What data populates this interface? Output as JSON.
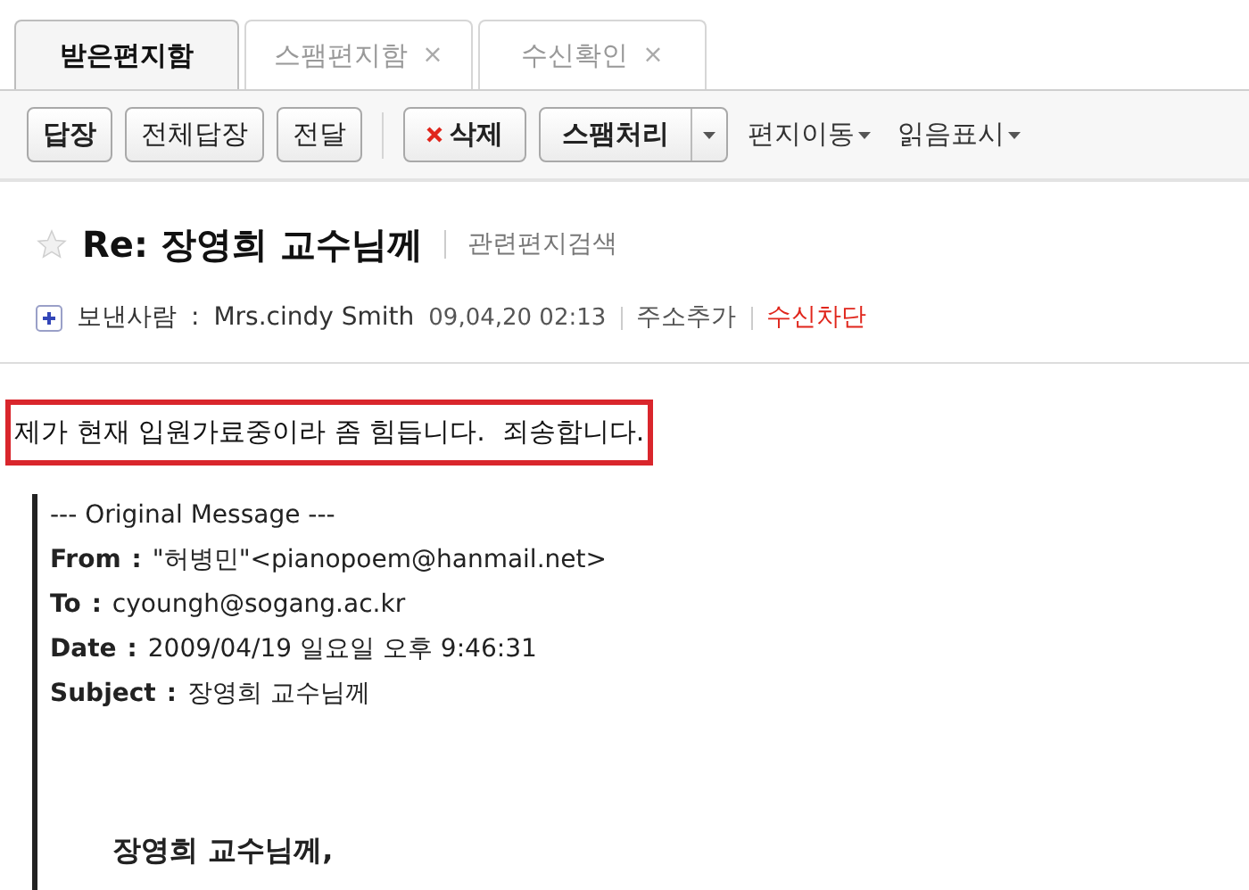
{
  "tabs": [
    {
      "label": "받은편지함",
      "selected": true
    },
    {
      "label": "스팸편지함",
      "selected": false,
      "close": "×"
    },
    {
      "label": "수신확인",
      "selected": false,
      "close": "×"
    }
  ],
  "toolbar": [
    {
      "kind": "button",
      "label": "답장",
      "bold": true
    },
    {
      "kind": "button",
      "label": "전체답장",
      "bold": false
    },
    {
      "kind": "button",
      "label": "전달",
      "bold": false
    },
    {
      "kind": "separator"
    },
    {
      "kind": "delete",
      "label": "삭제",
      "bold": true
    },
    {
      "kind": "split",
      "label": "스팸처리",
      "bold": true
    },
    {
      "kind": "menu",
      "label": "편지이동"
    },
    {
      "kind": "menu",
      "label": "읽음표시"
    }
  ],
  "message": {
    "starred": false,
    "subject": "Re: 장영희 교수님께",
    "related_link": "관련편지검색",
    "sender_label": "보낸사람",
    "sender_separator": ":",
    "sender": "Mrs.cindy Smith",
    "date": "09,04,20 02:13",
    "add_address": "주소추가",
    "block": "수신차단"
  },
  "body": {
    "highlighted": "제가 현재 입원가료중이라 좀 힘듭니다.  죄송합니다.",
    "quote_header": "--- Original Message ---",
    "headers": [
      {
        "label": "From",
        "value": "\"허병민\"<pianopoem@hanmail.net>"
      },
      {
        "label": "To",
        "value": "cyoungh@sogang.ac.kr"
      },
      {
        "label": "Date",
        "value": "2009/04/19 일요일 오후 9:46:31"
      },
      {
        "label": "Subject",
        "value": "장영희 교수님께"
      }
    ],
    "header_separator": ":",
    "greeting": "장영희 교수님께,"
  }
}
